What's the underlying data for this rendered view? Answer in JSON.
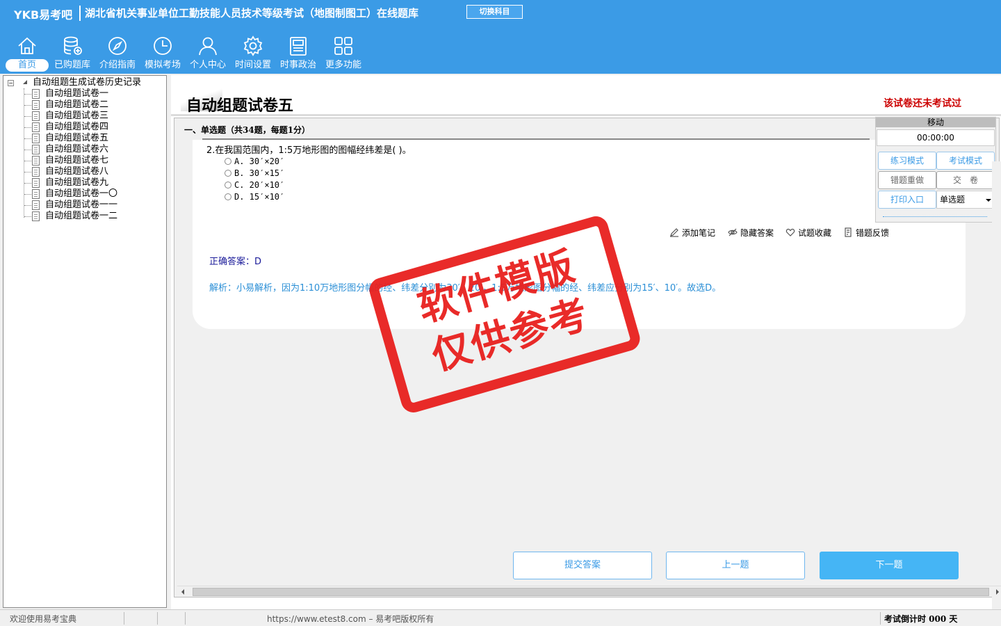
{
  "header": {
    "brand": "YKB易考吧",
    "title": "湖北省机关事业单位工勤技能人员技术等级考试（地图制图工）在线题库",
    "switch_label": "切换科目",
    "nav": [
      {
        "label": "首页",
        "icon": "home-icon",
        "active": true
      },
      {
        "label": "已购题库",
        "icon": "database-icon"
      },
      {
        "label": "介绍指南",
        "icon": "compass-icon"
      },
      {
        "label": "模拟考场",
        "icon": "clock-icon"
      },
      {
        "label": "个人中心",
        "icon": "user-icon"
      },
      {
        "label": "时间设置",
        "icon": "gear-icon"
      },
      {
        "label": "时事政治",
        "icon": "newspaper-icon"
      },
      {
        "label": "更多功能",
        "icon": "grid-icon"
      }
    ]
  },
  "tree": {
    "root": "自动组题生成试卷历史记录",
    "items": [
      "自动组题试卷一",
      "自动组题试卷二",
      "自动组题试卷三",
      "自动组题试卷四",
      "自动组题试卷五",
      "自动组题试卷六",
      "自动组题试卷七",
      "自动组题试卷八",
      "自动组题试卷九",
      "自动组题试卷一〇",
      "自动组题试卷一一",
      "自动组题试卷一二"
    ]
  },
  "paper": {
    "title": "自动组题试卷五",
    "status": "该试卷还未考试过"
  },
  "section": {
    "heading": "一、单选题（共34题，每题1分）"
  },
  "question": {
    "text": "2.在我国范围内，1:5万地形图的图幅经纬差是( )。",
    "options": [
      "A. 30′×20′",
      "B. 30′×15′",
      "C. 20′×10′",
      "D. 15′×10′"
    ],
    "answer": "正确答案：D",
    "analysis": "解析：小易解析，因为1:10万地形图分幅的经、纬差分别为30′、20′，1:5万地形图分幅的经、纬差应分别为15′、10′。故选D。"
  },
  "actions": {
    "note": "添加笔记",
    "hide": "隐藏答案",
    "fav": "试题收藏",
    "feedback": "错题反馈"
  },
  "control": {
    "move": "移动",
    "timer": "00:00:00",
    "practice": "练习模式",
    "exam": "考试模式",
    "redo": "错题重做",
    "submit_paper": "交　卷",
    "print": "打印入口",
    "qtype": "单选题"
  },
  "buttons": {
    "submit": "提交答案",
    "prev": "上一题",
    "next": "下一题"
  },
  "stamp": {
    "line1": "软件模版",
    "line2": "仅供参考"
  },
  "status": {
    "welcome": "欢迎使用易考宝典",
    "copyright": "https://www.etest8.com – 易考吧版权所有",
    "countdown": "考试倒计时 000 天"
  },
  "colors": {
    "header_bg": "#3b9be6",
    "accent": "#3b9be6",
    "status_red": "#cc0000",
    "stamp_red": "#e8201e"
  }
}
